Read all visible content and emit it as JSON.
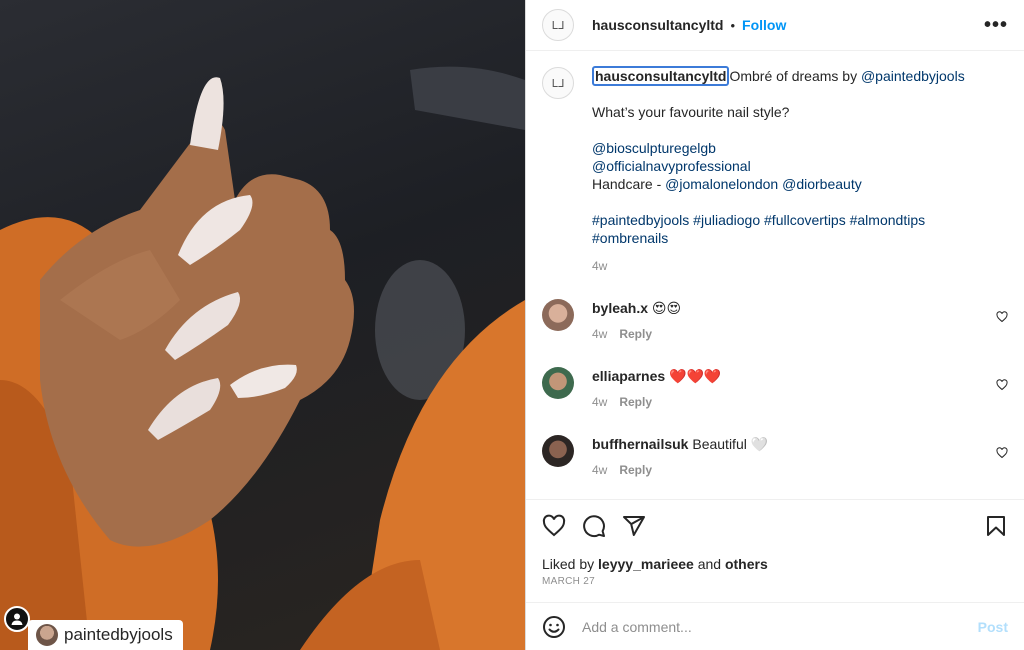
{
  "post": {
    "username": "hausconsultancyltd",
    "follow_label": "Follow",
    "separator": "•",
    "more_label": "•••",
    "logo_text": "ᒪᒧ"
  },
  "photo": {
    "tagged_user": "paintedbyjools"
  },
  "caption": {
    "username": "hausconsultancyltd",
    "text1": "Ombré of dreams by ",
    "mention1": "@paintedbyjools",
    "question": "What’s your favourite nail style?",
    "mention2": "@biosculpturegelgb",
    "mention3": "@officialnavyprofessional",
    "handcare_prefix": "Handcare - ",
    "mention4": "@jomalonelondon",
    "mention5": "@diorbeauty",
    "hashtags_line1": "#paintedbyjools #juliadiogo #fullcovertips #almondtips",
    "hashtags_line2": "#ombrenails",
    "age": "4w"
  },
  "comments": [
    {
      "username": "byleah.x",
      "text": "😍😍",
      "age": "4w",
      "reply_label": "Reply",
      "avatar_color": "#b88a78"
    },
    {
      "username": "elliaparnes",
      "text": "❤️❤️❤️",
      "age": "4w",
      "reply_label": "Reply",
      "avatar_color": "#5a4a3e"
    },
    {
      "username": "buffhernailsuk",
      "text": "Beautiful 🤍",
      "age": "4w",
      "reply_label": "Reply",
      "avatar_color": "#3d3330"
    }
  ],
  "actions": {
    "liked_prefix": "Liked by ",
    "liked_user": "leyyy_marieee",
    "liked_and": " and ",
    "liked_others": "others",
    "date": "MARCH 27"
  },
  "add_comment": {
    "placeholder": "Add a comment...",
    "post_label": "Post"
  }
}
